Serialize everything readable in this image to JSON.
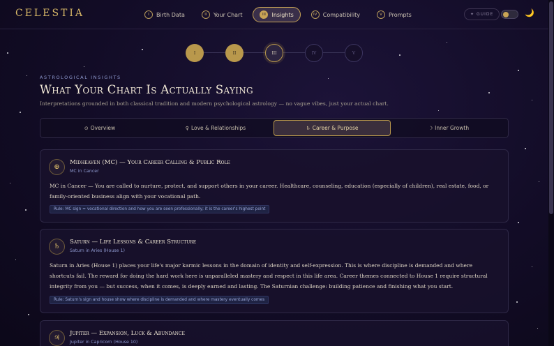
{
  "app": {
    "logo": "CELESTIA"
  },
  "nav": [
    {
      "num": "I",
      "label": "Birth Data",
      "active": false
    },
    {
      "num": "II",
      "label": "Your Chart",
      "active": false
    },
    {
      "num": "III",
      "label": "Insights",
      "active": true
    },
    {
      "num": "IV",
      "label": "Compatibility",
      "active": false
    },
    {
      "num": "V",
      "label": "Prompts",
      "active": false
    }
  ],
  "header_controls": {
    "guide_label": "GUIDE",
    "guide_icon": "✦",
    "theme_icon": "🌙",
    "theme": "dark"
  },
  "steps": [
    {
      "label": "I",
      "state": "done"
    },
    {
      "label": "II",
      "state": "done"
    },
    {
      "label": "III",
      "state": "current"
    },
    {
      "label": "IV",
      "state": "todo"
    },
    {
      "label": "V",
      "state": "todo"
    }
  ],
  "section": {
    "eyebrow": "ASTROLOGICAL INSIGHTS",
    "title": "What Your Chart Is Actually Saying",
    "subtitle": "Interpretations grounded in both classical tradition and modern psychological astrology — no vague vibes, just your actual chart."
  },
  "tabs": [
    {
      "icon": "⊙",
      "label": "Overview",
      "active": false
    },
    {
      "icon": "♀",
      "label": "Love & Relationships",
      "active": false
    },
    {
      "icon": "♄",
      "label": "Career & Purpose",
      "active": true
    },
    {
      "icon": "☽",
      "label": "Inner Growth",
      "active": false
    }
  ],
  "cards": [
    {
      "icon": "⊕",
      "title": "Midheaven (MC) — Your Career Calling & Public Role",
      "subtitle": "MC in Cancer",
      "body": "MC in Cancer — You are called to nurture, protect, and support others in your career. Healthcare, counseling, education (especially of children), real estate, food, or family-oriented business align with your vocational path.",
      "rule": "Rule: MC sign = vocational direction and how you are seen professionally; it is the career's highest point"
    },
    {
      "icon": "♄",
      "title": "Saturn — Life Lessons & Career Structure",
      "subtitle": "Saturn in Aries (House 1)",
      "body": "Saturn in Aries (House 1) places your life's major karmic lessons in the domain of identity and self-expression. This is where discipline is demanded and where shortcuts fail. The reward for doing the hard work here is unparalleled mastery and respect in this life area. Career themes connected to House 1 require structural integrity from you — but success, when it comes, is deeply earned and lasting. The Saturnian challenge: building patience and finishing what you start.",
      "rule": "Rule: Saturn's sign and house show where discipline is demanded and where mastery eventually comes"
    },
    {
      "icon": "♃",
      "title": "Jupiter — Expansion, Luck & Abundance",
      "subtitle": "Jupiter in Capricorn (House 10)"
    }
  ]
}
